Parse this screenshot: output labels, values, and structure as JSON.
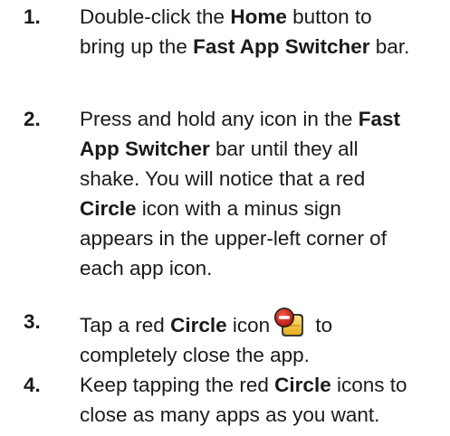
{
  "steps": [
    {
      "number": "1.",
      "lines": [
        [
          "Double-click the ",
          "Home",
          " button to"
        ],
        [
          "bring up the ",
          "Fast App Switcher",
          " bar."
        ]
      ]
    },
    {
      "number": "2.",
      "lines": [
        [
          "Press and hold any icon in the ",
          "Fast"
        ],
        [
          "App Switcher",
          " bar until they all"
        ],
        [
          "shake. You will notice that a red"
        ],
        [
          "Circle",
          " icon with a minus sign"
        ],
        [
          "appears in the upper-left corner of"
        ],
        [
          "each app icon."
        ]
      ]
    },
    {
      "number": "3.",
      "lines": [
        [
          "Tap a red ",
          "Circle",
          " icon",
          " to"
        ],
        [
          "completely close the app."
        ]
      ]
    },
    {
      "number": "4.",
      "lines": [
        [
          "Keep tapping the red ",
          "Circle",
          " icons to"
        ],
        [
          "close as many apps as you want."
        ]
      ]
    }
  ],
  "icons": {
    "inline_icon": "red-circle-minus-close-icon",
    "circle_color": "#d8231c",
    "app_color": "#f2c230"
  }
}
